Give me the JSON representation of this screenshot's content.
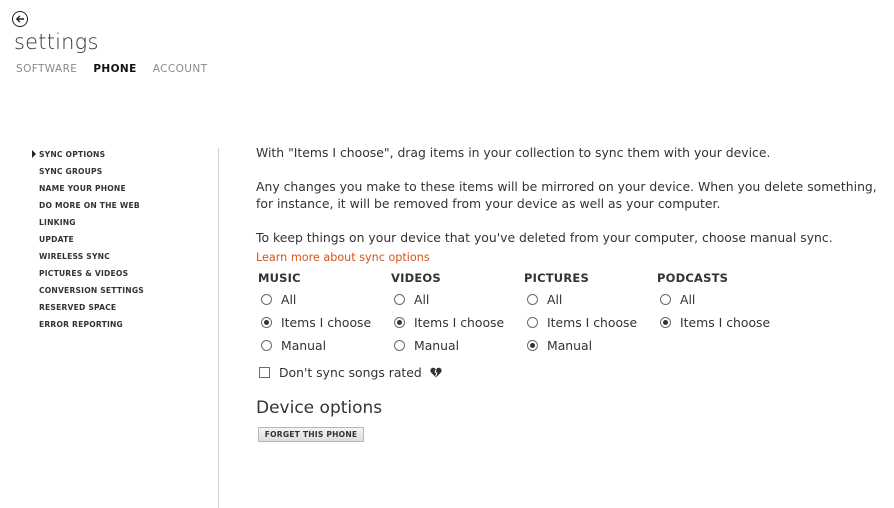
{
  "header": {
    "title": "settings",
    "tabs": [
      {
        "label": "SOFTWARE",
        "active": false
      },
      {
        "label": "PHONE",
        "active": true
      },
      {
        "label": "ACCOUNT",
        "active": false
      }
    ]
  },
  "sidebar": {
    "items": [
      {
        "label": "SYNC OPTIONS",
        "active": true
      },
      {
        "label": "SYNC GROUPS"
      },
      {
        "label": "NAME YOUR PHONE"
      },
      {
        "label": "DO MORE ON THE WEB"
      },
      {
        "label": "LINKING"
      },
      {
        "label": "UPDATE"
      },
      {
        "label": "WIRELESS SYNC"
      },
      {
        "label": "PICTURES & VIDEOS"
      },
      {
        "label": "CONVERSION SETTINGS"
      },
      {
        "label": "RESERVED SPACE"
      },
      {
        "label": "ERROR REPORTING"
      }
    ]
  },
  "main": {
    "intro": "With \"Items I choose\", drag items in your collection to sync them with your device.",
    "mirror_line1": "Any changes you make to these items will be mirrored on your device. When you delete something,",
    "mirror_line2": "for instance, it will be removed from your device as well as your computer.",
    "manual_note": "To keep things on your device that you've deleted from your computer, choose manual sync.",
    "learn_more": "Learn more about sync options",
    "columns": [
      {
        "heading": "MUSIC",
        "options": [
          "All",
          "Items I choose",
          "Manual"
        ],
        "selected": "Items I choose"
      },
      {
        "heading": "VIDEOS",
        "options": [
          "All",
          "Items I choose",
          "Manual"
        ],
        "selected": "Items I choose"
      },
      {
        "heading": "PICTURES",
        "options": [
          "All",
          "Items I choose",
          "Manual"
        ],
        "selected": "Manual"
      },
      {
        "heading": "PODCASTS",
        "options": [
          "All",
          "Items I choose"
        ],
        "selected": "Items I choose"
      }
    ],
    "dont_sync_label": "Don't sync songs rated",
    "dont_sync_checked": false,
    "rating_icon": "broken-heart-icon",
    "device_options_title": "Device options",
    "forget_button": "FORGET THIS PHONE"
  },
  "colors": {
    "link": "#d5541a",
    "text": "#333333",
    "inactive_tab": "#8a8a8a"
  }
}
